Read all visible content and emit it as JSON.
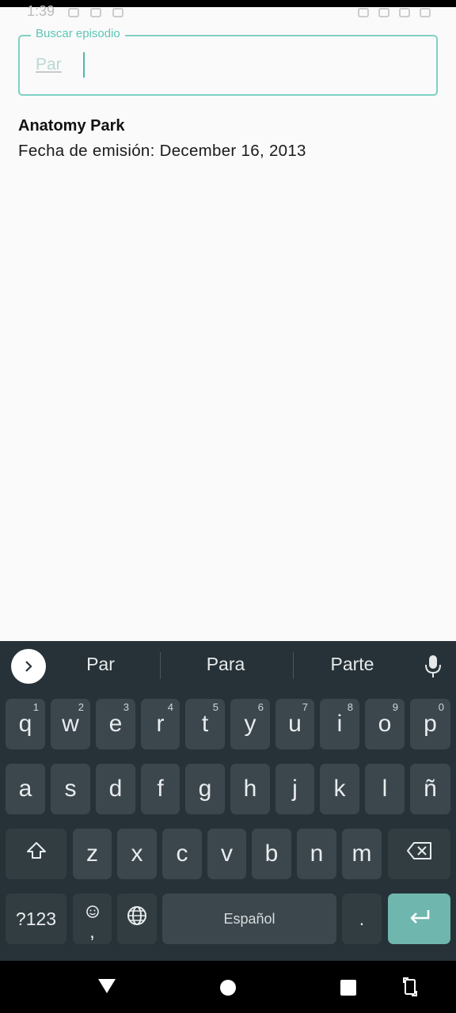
{
  "status_bar": {
    "time": "1:39"
  },
  "search": {
    "label": "Buscar episodio",
    "value": "Par"
  },
  "result": {
    "title": "Anatomy Park",
    "air_date": "Fecha de emisión: December 16, 2013"
  },
  "keyboard": {
    "suggestions": [
      "Par",
      "Para",
      "Parte"
    ],
    "row1": [
      {
        "key": "q",
        "hint": "1"
      },
      {
        "key": "w",
        "hint": "2"
      },
      {
        "key": "e",
        "hint": "3"
      },
      {
        "key": "r",
        "hint": "4"
      },
      {
        "key": "t",
        "hint": "5"
      },
      {
        "key": "y",
        "hint": "6"
      },
      {
        "key": "u",
        "hint": "7"
      },
      {
        "key": "i",
        "hint": "8"
      },
      {
        "key": "o",
        "hint": "9"
      },
      {
        "key": "p",
        "hint": "0"
      }
    ],
    "row2": [
      "a",
      "s",
      "d",
      "f",
      "g",
      "h",
      "j",
      "k",
      "l",
      "ñ"
    ],
    "row3": [
      "z",
      "x",
      "c",
      "v",
      "b",
      "n",
      "m"
    ],
    "symbols_label": "?123",
    "emoji_comma": ",",
    "space_label": "Español",
    "period": "."
  },
  "icons": {
    "suggest_toggle": "chevron-right-icon",
    "mic": "mic-icon",
    "shift": "shift-icon",
    "backspace": "backspace-icon",
    "emoji": "emoji-icon",
    "globe": "globe-icon",
    "enter": "enter-icon",
    "nav_back": "back-triangle-icon",
    "nav_home": "home-circle-icon",
    "nav_recents": "recents-square-icon",
    "rotate": "rotate-icon"
  },
  "colors": {
    "accent": "#7fd1c4",
    "keyboard_bg": "#263238",
    "key_bg": "#3c474d",
    "enter_bg": "#6fb6ae"
  }
}
